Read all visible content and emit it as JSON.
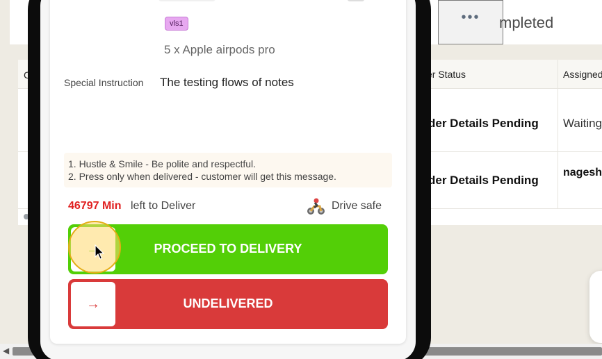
{
  "background": {
    "more_button": "•••",
    "tab_completed": "mpleted",
    "table": {
      "header_first": "C",
      "header_status": "er Status",
      "header_assigned": "Assigned",
      "rows": [
        {
          "status": "der Details Pending",
          "assigned": "Waiting"
        },
        {
          "status": "der Details Pending",
          "assigned": "nagesh"
        }
      ]
    },
    "scroll_arrow": "◀"
  },
  "order": {
    "badge": "vls1",
    "item": "5 x Apple airpods pro",
    "special_instruction_label": "Special Instruction",
    "special_instruction_text": "The testing flows of notes",
    "notes": [
      "1. Hustle & Smile - Be polite and respectful.",
      "2. Press only when delivered - customer will get this message."
    ],
    "minutes_value": "46797 Min",
    "minutes_suffix": "left to Deliver",
    "drive_safe": "Drive safe",
    "drive_icon": "motorbike-rider-icon"
  },
  "actions": {
    "proceed_label": "PROCEED TO DELIVERY",
    "undelivered_label": "UNDELIVERED",
    "arrow_glyph": "→",
    "proceed_color": "#53cf07",
    "undelivered_color": "#d93a3a"
  },
  "colors": {
    "accent_green": "#53cf07",
    "accent_red": "#d93a3a",
    "minutes_red": "#e02020",
    "badge_purple": "#e7a8f0"
  }
}
